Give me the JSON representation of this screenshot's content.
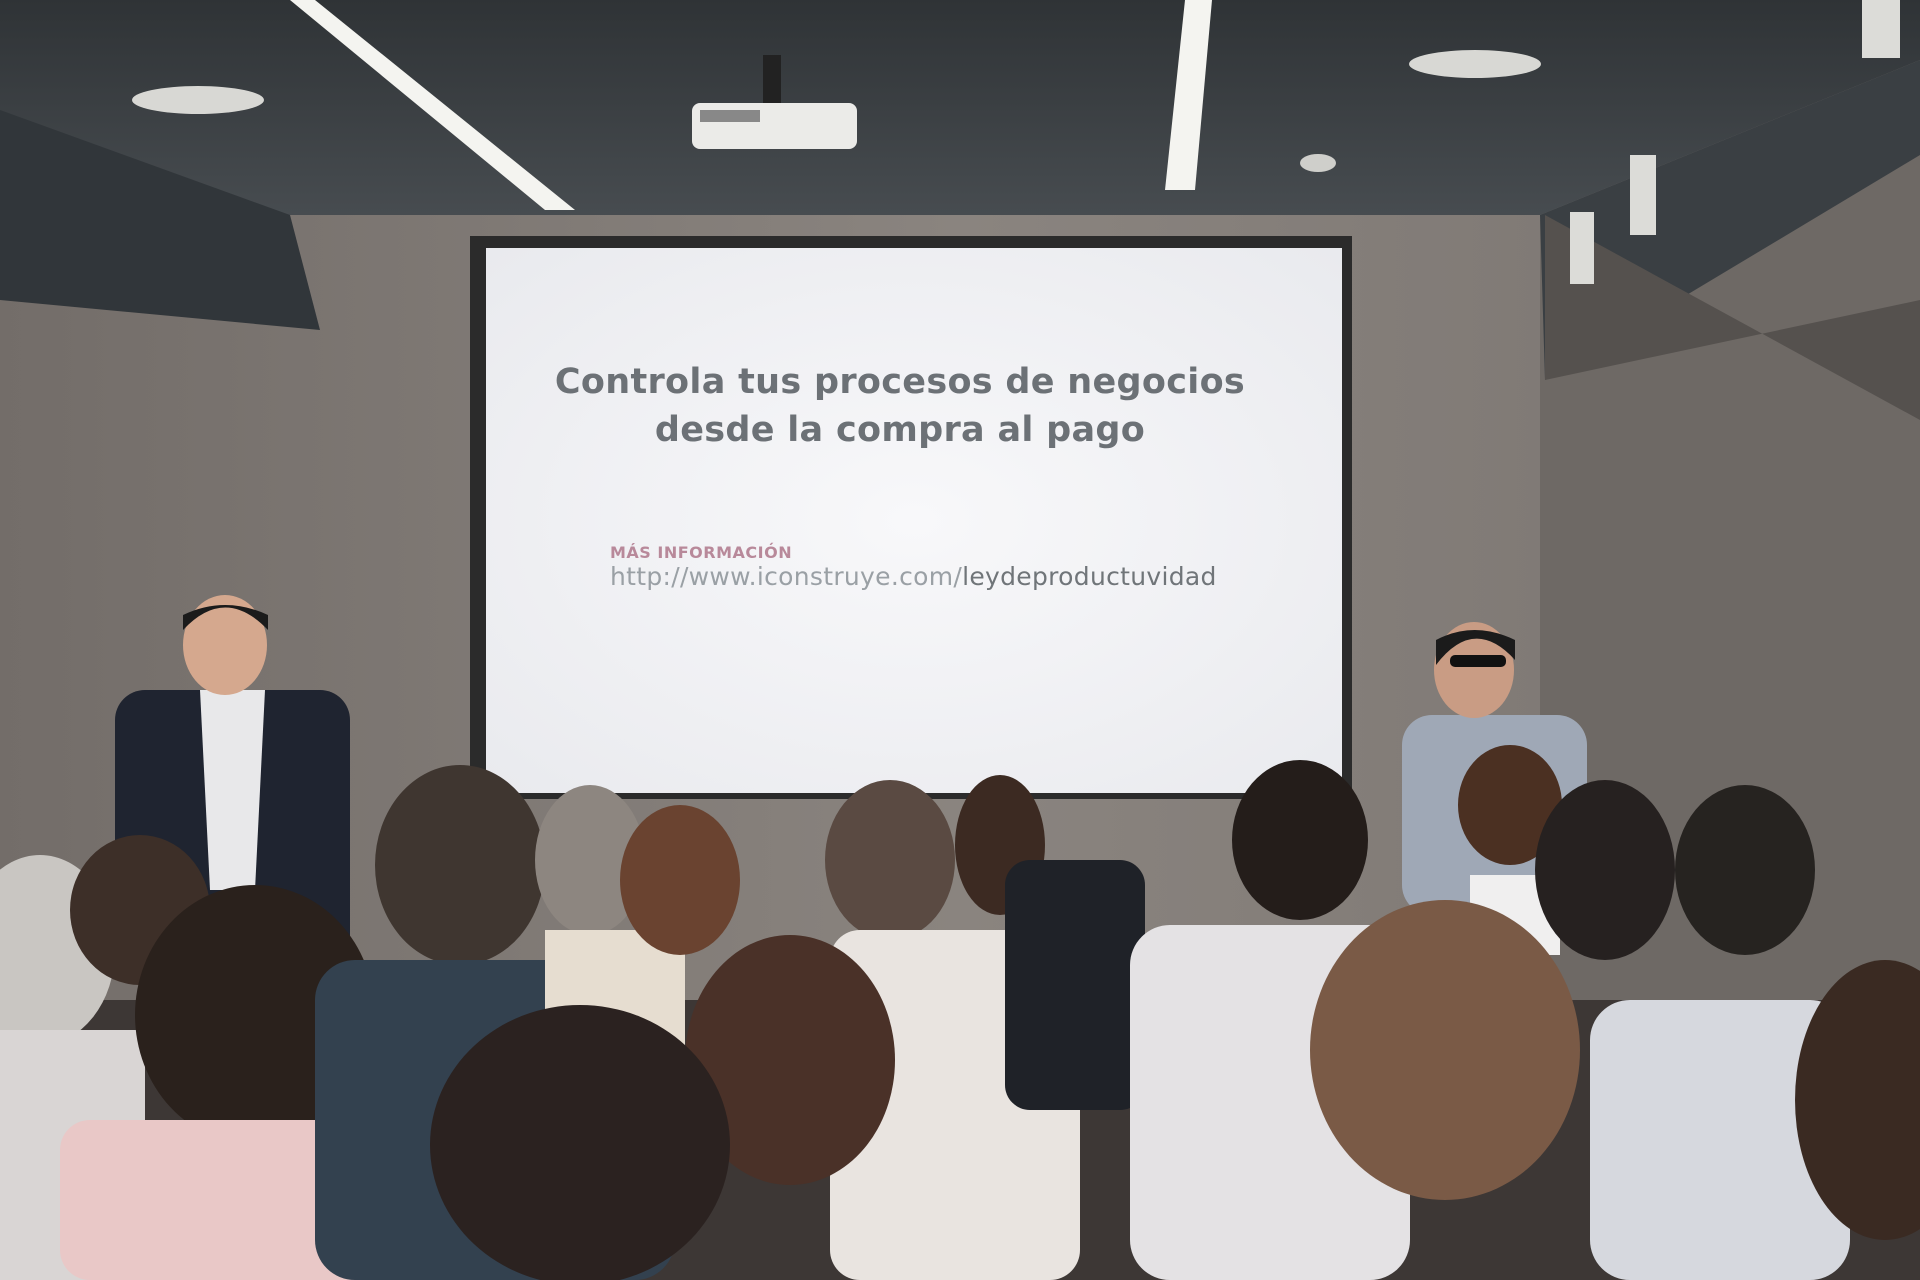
{
  "slide": {
    "title_line_1": "Controla tus procesos de negocios",
    "title_line_2": "desde la compra al pago",
    "more_info_label": "MÁS INFORMACIÓN",
    "url_prefix": "http://www.iconstruye.com/",
    "url_path": "leydeproductuvidad"
  },
  "colors": {
    "wall": "#7d7874",
    "ceiling": "#3d4347",
    "screen": "#f3f4f6",
    "title_text": "#6c7176",
    "accent_label": "#b8899a"
  }
}
